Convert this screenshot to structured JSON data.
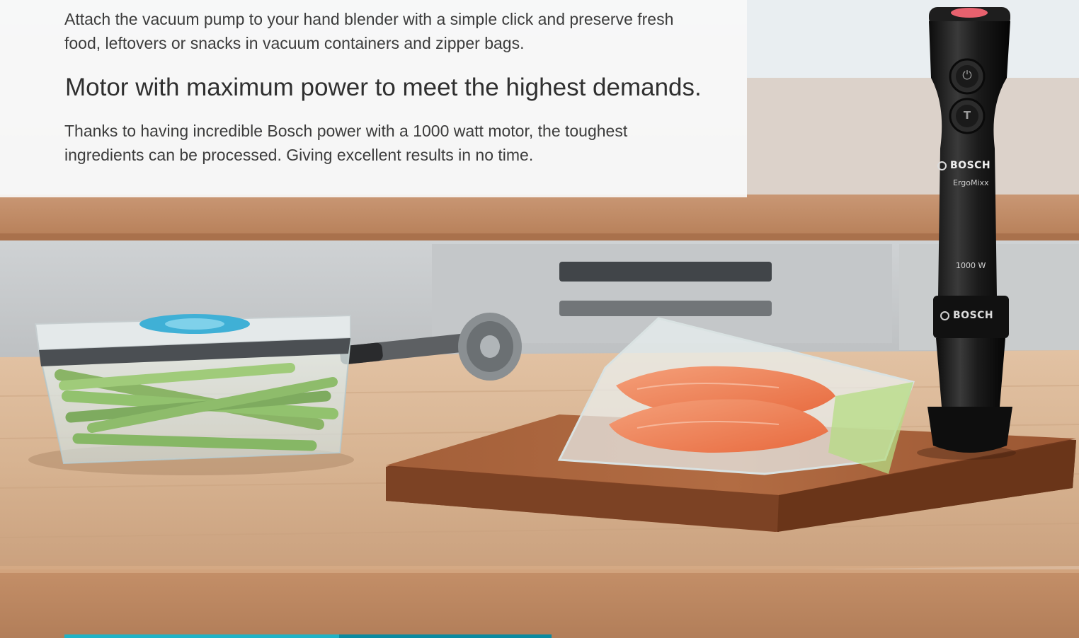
{
  "content": {
    "paragraph_vacuum": "Attach the vacuum pump to your hand blender with a simple click and preserve fresh food, leftovers or snacks in vacuum containers and zipper bags.",
    "heading_motor": "Motor with maximum power to meet the highest demands.",
    "paragraph_motor": "Thanks to having incredible Bosch power with a 1000 watt motor, the toughest ingredients can be processed. Giving excellent results in no time."
  },
  "product": {
    "brand": "BOSCH",
    "model": "ErgoMixx",
    "power": "1000 W",
    "brand_lower": "BOSCH"
  },
  "colors": {
    "accent": "#1fb3c6",
    "accent_secondary": "#0a8aa0",
    "text": "#3c3c3c"
  },
  "icons": {
    "power_button": "power-icon",
    "turbo_button": "turbo-icon",
    "bosch_logo": "bosch-logo-icon"
  }
}
